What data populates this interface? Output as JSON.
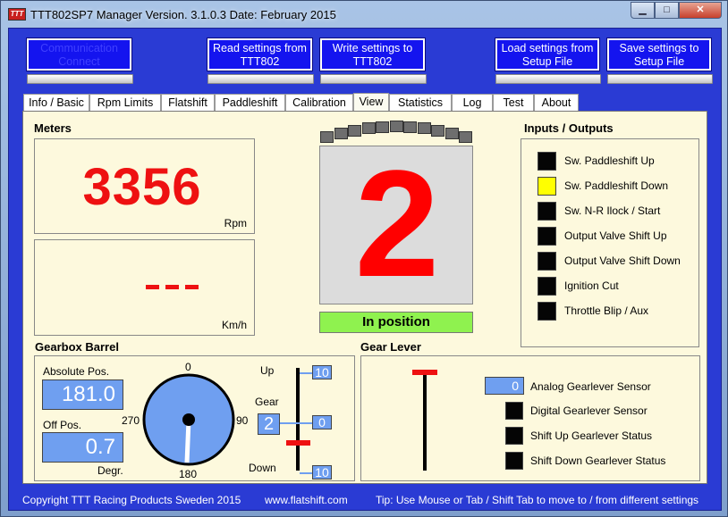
{
  "window": {
    "title": "TTT802SP7 Manager Version. 3.1.0.3  Date: February 2015",
    "icon_text": "TTT",
    "min_glyph": "▁",
    "max_glyph": "□",
    "close_glyph": "✕"
  },
  "toolbar": {
    "comm_label_1": "Communication",
    "comm_label_2": "Connect",
    "read_label_1": "Read settings from",
    "read_label_2": "TTT802",
    "write_label_1": "Write settings to",
    "write_label_2": "TTT802",
    "load_label_1": "Load settings from",
    "load_label_2": "Setup File",
    "save_label_1": "Save settings to",
    "save_label_2": "Setup File"
  },
  "tabs": [
    {
      "label": "Info / Basic"
    },
    {
      "label": "Rpm Limits"
    },
    {
      "label": "Flatshift"
    },
    {
      "label": "Paddleshift"
    },
    {
      "label": "Calibration"
    },
    {
      "label": "View"
    },
    {
      "label": "Statistics"
    },
    {
      "label": "Log"
    },
    {
      "label": "Test"
    },
    {
      "label": "About"
    }
  ],
  "meters": {
    "title": "Meters",
    "rpm_value": "3356",
    "rpm_unit": "Rpm",
    "kmh_unit": "Km/h"
  },
  "gear": {
    "current": "2",
    "status": "In position"
  },
  "io": {
    "title": "Inputs / Outputs",
    "items": [
      {
        "label": "Sw. Paddleshift Up",
        "color": "#050505"
      },
      {
        "label": "Sw. Paddleshift Down",
        "color": "#ffff00"
      },
      {
        "label": "Sw. N-R Ilock / Start",
        "color": "#050505"
      },
      {
        "label": "Output Valve Shift Up",
        "color": "#050505"
      },
      {
        "label": "Output Valve Shift Down",
        "color": "#050505"
      },
      {
        "label": "Ignition Cut",
        "color": "#050505"
      },
      {
        "label": "Throttle Blip / Aux",
        "color": "#050505"
      }
    ]
  },
  "barrel": {
    "title": "Gearbox Barrel",
    "abs_label": "Absolute Pos.",
    "abs_value": "181.0",
    "off_label": "Off Pos.",
    "off_value": "0.7",
    "deg_label": "Degr.",
    "dial_0": "0",
    "dial_90": "90",
    "dial_180": "180",
    "dial_270": "270",
    "up_label": "Up",
    "up_value": "10",
    "gear_label": "Gear",
    "gear_value": "2",
    "gear_mid_value": "0",
    "down_label": "Down",
    "down_value": "10"
  },
  "lever": {
    "title": "Gear Lever",
    "analog_value": "0",
    "analog_label": "Analog Gearlever Sensor",
    "digital_label": "Digital Gearlever Sensor",
    "shift_up_label": "Shift Up Gearlever Status",
    "shift_down_label": "Shift Down Gearlever Status"
  },
  "status": {
    "copyright": "Copyright TTT Racing Products Sweden  2015",
    "url": "www.flatshift.com",
    "tip": "Tip:  Use Mouse or Tab / Shift Tab to move to / from  different settings"
  },
  "colors": {
    "accent_blue": "#1414ef",
    "alert_red": "#ee1111",
    "ok_green": "#8ff24f",
    "value_blue": "#6f9ff0"
  }
}
